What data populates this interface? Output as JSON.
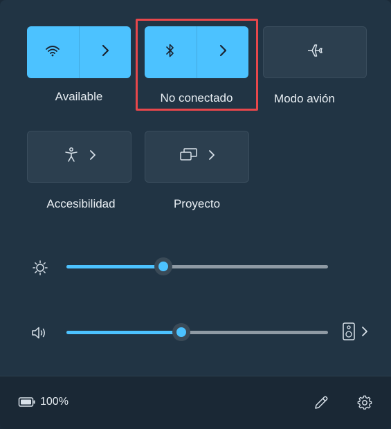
{
  "tiles": {
    "wifi": {
      "label": "Available",
      "icon": "wifi-icon",
      "state": "on"
    },
    "bluetooth": {
      "label": "No conectado",
      "icon": "bluetooth-icon",
      "state": "on"
    },
    "airplane": {
      "label": "Modo avión",
      "icon": "airplane-icon",
      "state": "off"
    },
    "accessibility": {
      "label": "Accesibilidad",
      "icon": "accessibility-icon",
      "state": "off"
    },
    "project": {
      "label": "Proyecto",
      "icon": "project-icon",
      "state": "off"
    }
  },
  "sliders": {
    "brightness": {
      "icon": "brightness-icon",
      "value_fraction": 0.37
    },
    "volume": {
      "icon": "speaker-icon",
      "value_fraction": 0.44,
      "output_icon": "audio-output-icon"
    }
  },
  "footer": {
    "battery_percent": "100%",
    "battery_icon": "battery-icon",
    "edit_icon": "pencil-icon",
    "settings_icon": "gear-icon"
  },
  "colors": {
    "accent": "#4cc2ff",
    "panel": "#213444",
    "highlight": "#e8474b"
  }
}
